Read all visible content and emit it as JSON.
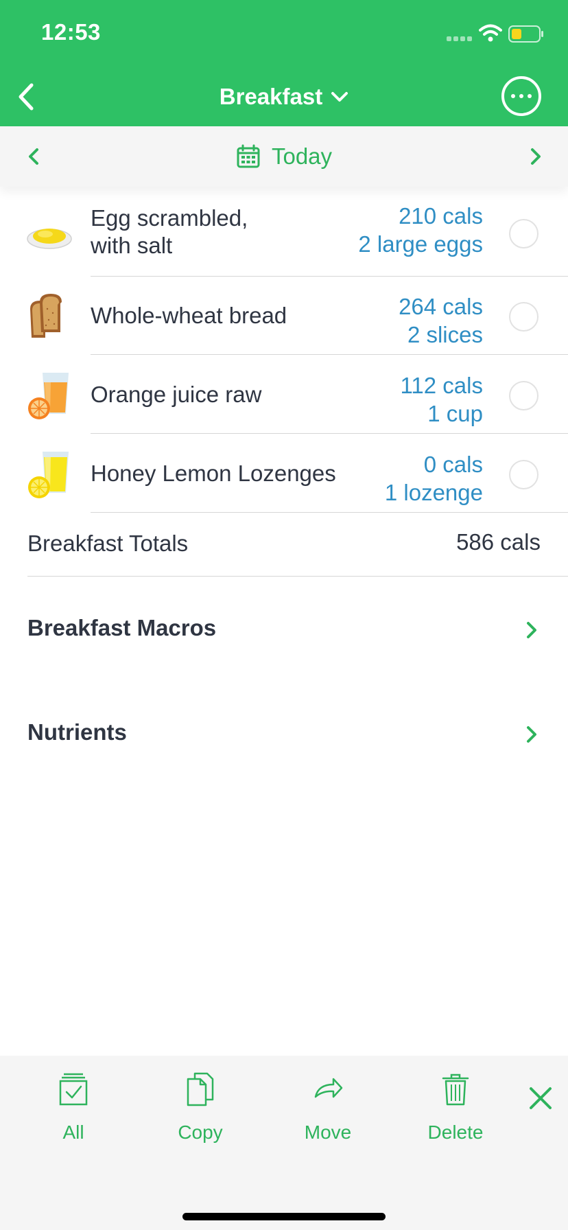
{
  "status_bar": {
    "time": "12:53"
  },
  "header": {
    "title": "Breakfast"
  },
  "date_nav": {
    "label": "Today"
  },
  "foods": [
    {
      "name_line1": "Egg scrambled,",
      "name_line2": "with salt",
      "cals": "210 cals",
      "amount": "2 large eggs",
      "icon": "scrambled-egg-icon"
    },
    {
      "name_line1": "Whole-wheat bread",
      "cals": "264 cals",
      "amount": "2 slices",
      "icon": "bread-icon"
    },
    {
      "name_line1": "Orange juice raw",
      "cals": "112 cals",
      "amount": "1 cup",
      "icon": "orange-juice-icon"
    },
    {
      "name_line1": "Honey Lemon Lozenges",
      "cals": "0 cals",
      "amount": "1 lozenge",
      "icon": "lemon-drink-icon"
    }
  ],
  "totals": {
    "label": "Breakfast Totals",
    "value": "586 cals"
  },
  "sections": {
    "macros": "Breakfast Macros",
    "nutrients": "Nutrients"
  },
  "toolbar": {
    "all": "All",
    "copy": "Copy",
    "move": "Move",
    "delete": "Delete"
  },
  "colors": {
    "brand_green": "#2ec165",
    "accent_green": "#2eb35c",
    "amount_blue": "#2f8ec4",
    "text_dark": "#2f3542"
  }
}
